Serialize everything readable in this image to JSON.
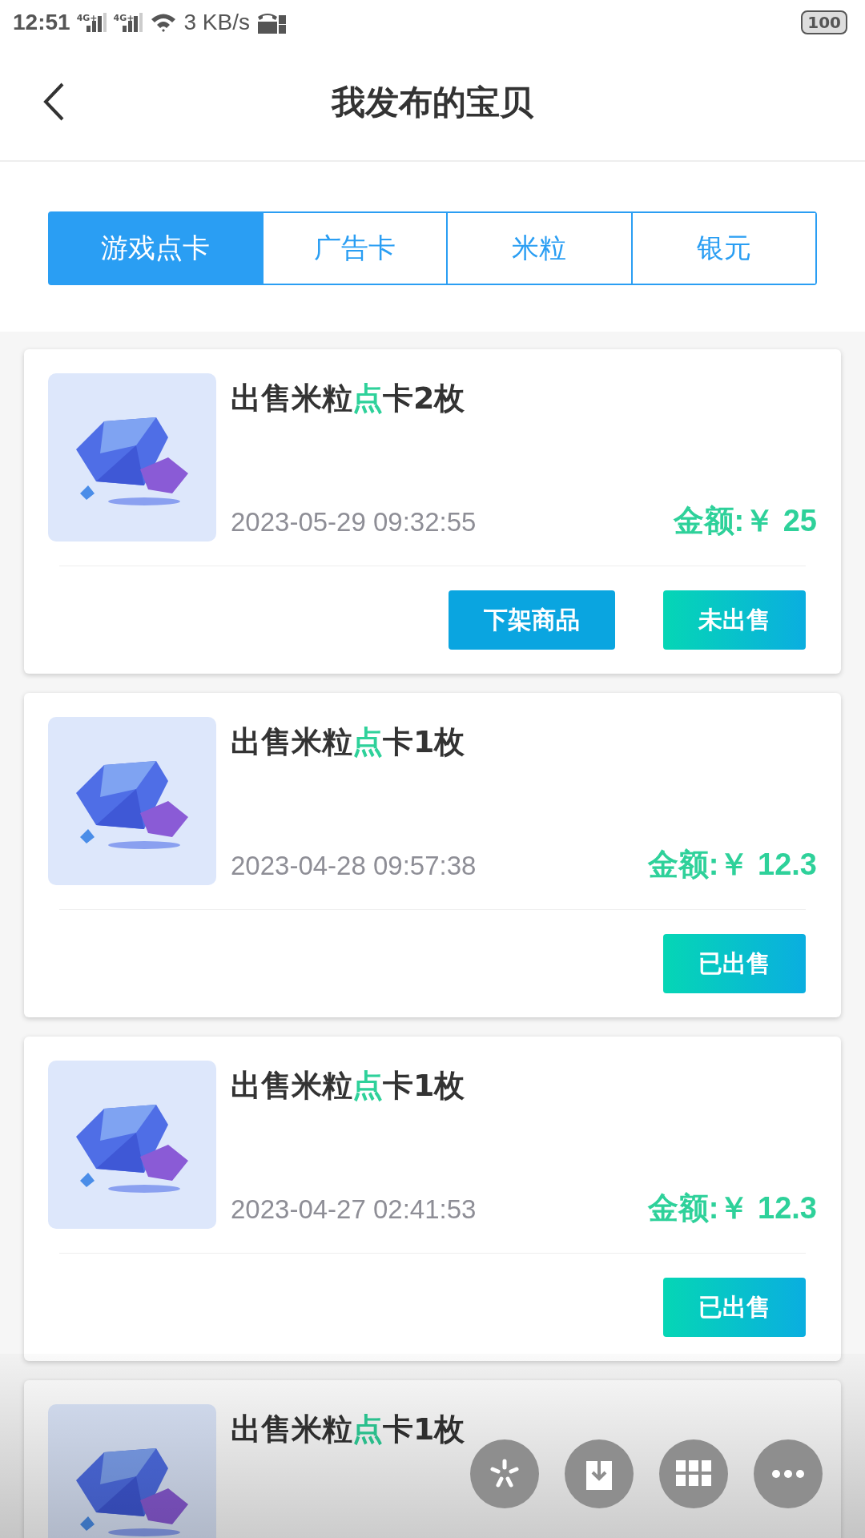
{
  "status_bar": {
    "time": "12:51",
    "network_labels": [
      "4G+",
      "4G+"
    ],
    "speed": "3 KB/s",
    "battery": "100"
  },
  "header": {
    "title": "我发布的宝贝"
  },
  "tabs": [
    {
      "label": "游戏点卡",
      "selected": true
    },
    {
      "label": "广告卡",
      "selected": false
    },
    {
      "label": "米粒",
      "selected": false
    },
    {
      "label": "银元",
      "selected": false
    }
  ],
  "items": [
    {
      "title": [
        {
          "text": "出售米粒",
          "highlight": false
        },
        {
          "text": "点",
          "highlight": true
        },
        {
          "text": "卡2枚",
          "highlight": false
        }
      ],
      "date": "2023-05-29 09:32:55",
      "price_label": "金额:",
      "price": "￥ 25",
      "buttons": [
        {
          "label": "下架商品",
          "kind": "delist"
        },
        {
          "label": "未出售",
          "kind": "status"
        }
      ]
    },
    {
      "title": [
        {
          "text": "出售米粒",
          "highlight": false
        },
        {
          "text": "点",
          "highlight": true
        },
        {
          "text": "卡1枚",
          "highlight": false
        }
      ],
      "date": "2023-04-28 09:57:38",
      "price_label": "金额:",
      "price": "￥ 12.3",
      "buttons": [
        {
          "label": "已出售",
          "kind": "status"
        }
      ]
    },
    {
      "title": [
        {
          "text": "出售米粒",
          "highlight": false
        },
        {
          "text": "点",
          "highlight": true
        },
        {
          "text": "卡1枚",
          "highlight": false
        }
      ],
      "date": "2023-04-27 02:41:53",
      "price_label": "金额:",
      "price": "￥ 12.3",
      "buttons": [
        {
          "label": "已出售",
          "kind": "status"
        }
      ]
    },
    {
      "title": [
        {
          "text": "出售米粒",
          "highlight": false
        },
        {
          "text": "点",
          "highlight": true
        },
        {
          "text": "卡1枚",
          "highlight": false
        }
      ]
    }
  ],
  "floating_actions": [
    {
      "kind": "sparkle"
    },
    {
      "kind": "download"
    },
    {
      "kind": "grid"
    },
    {
      "kind": "more"
    }
  ]
}
